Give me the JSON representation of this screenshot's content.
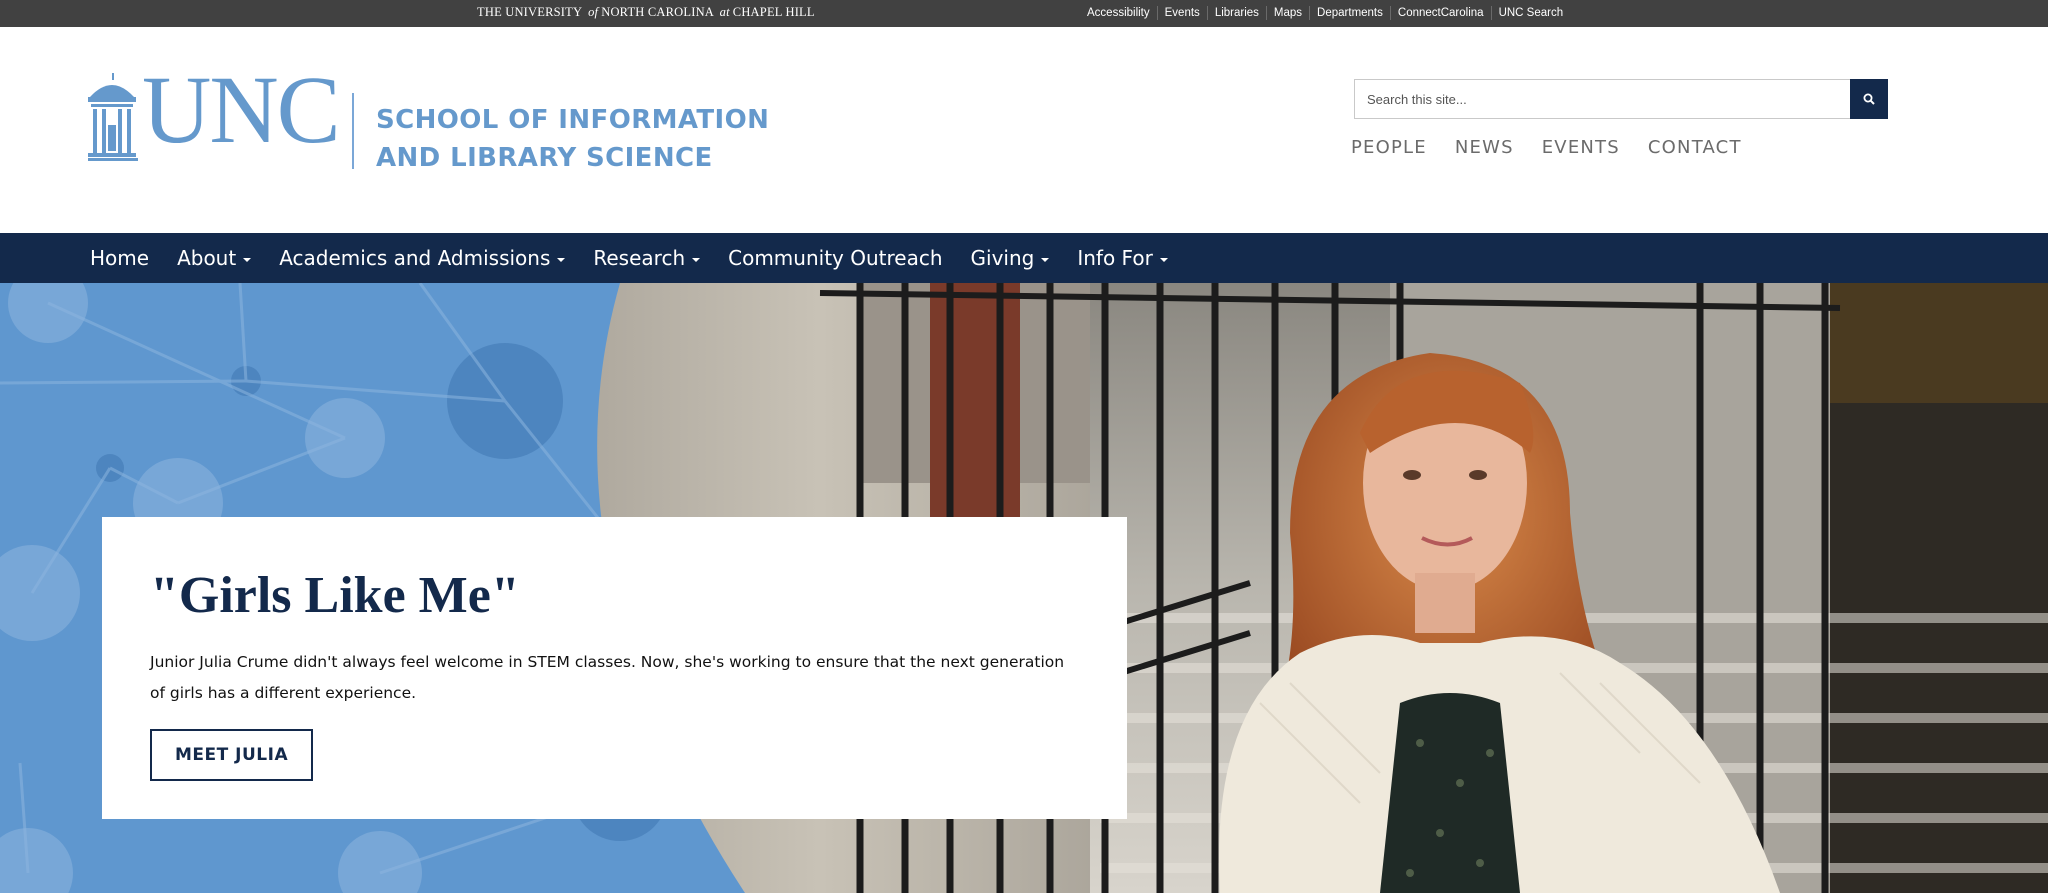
{
  "utility_bar": {
    "wordmark": {
      "the_university": "THE UNIVERSITY",
      "of": "of",
      "north_carolina": "NORTH CAROLINA",
      "at": "at",
      "chapel_hill": "CHAPEL HILL"
    },
    "links": [
      "Accessibility",
      "Events",
      "Libraries",
      "Maps",
      "Departments",
      "ConnectCarolina",
      "UNC Search"
    ]
  },
  "header": {
    "logo_text": "UNC",
    "school_line1": "SCHOOL OF INFORMATION",
    "school_line2": "AND LIBRARY SCIENCE",
    "search": {
      "placeholder": "Search this site...",
      "icon": "search-icon"
    },
    "quick_links": [
      "PEOPLE",
      "NEWS",
      "EVENTS",
      "CONTACT"
    ]
  },
  "nav": {
    "items": [
      {
        "label": "Home",
        "dropdown": false
      },
      {
        "label": "About",
        "dropdown": true
      },
      {
        "label": "Academics and Admissions",
        "dropdown": true
      },
      {
        "label": "Research",
        "dropdown": true
      },
      {
        "label": "Community Outreach",
        "dropdown": false
      },
      {
        "label": "Giving",
        "dropdown": true
      },
      {
        "label": "Info For",
        "dropdown": true
      }
    ]
  },
  "hero": {
    "title": "\"Girls Like Me\"",
    "text": "Junior Julia Crume didn't always feel welcome in STEM classes. Now, she's working to ensure that the next generation of girls has a different experience.",
    "button_label": "MEET JULIA"
  },
  "colors": {
    "carolina_blue": "#6599cc",
    "navy": "#13294b",
    "utility_bar": "#414141",
    "hero_pattern_blue": "#5f97cf"
  }
}
